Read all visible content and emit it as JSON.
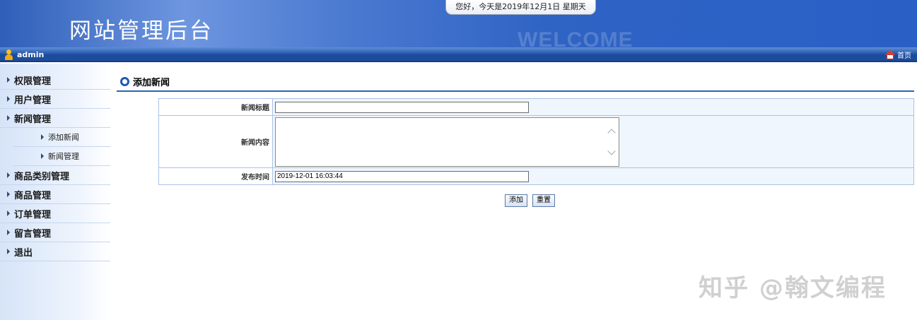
{
  "header": {
    "title": "网站管理后台",
    "welcome_text": "WELCOME",
    "greeting": "您好，今天是2019年12月1日 星期天"
  },
  "topbar": {
    "username": "admin",
    "home_label": "首页"
  },
  "sidebar": {
    "items": [
      {
        "label": "权限管理"
      },
      {
        "label": "用户管理"
      },
      {
        "label": "新闻管理"
      },
      {
        "label": "商品类别管理"
      },
      {
        "label": "商品管理"
      },
      {
        "label": "订单管理"
      },
      {
        "label": "留言管理"
      },
      {
        "label": "退出"
      }
    ],
    "sub_items": [
      {
        "label": "添加新闻"
      },
      {
        "label": "新闻管理"
      }
    ]
  },
  "main": {
    "page_title": "添加新闻",
    "form": {
      "title_label": "新闻标题",
      "title_value": "",
      "content_label": "新闻内容",
      "content_value": "",
      "time_label": "发布时间",
      "time_value": "2019-12-01 16:03:44"
    },
    "buttons": {
      "add": "添加",
      "reset": "重置"
    }
  },
  "watermark": "知乎 @翰文编程",
  "colors": {
    "header_blue": "#2a60c6",
    "topbar_blue": "#1c4c9a",
    "rule_blue": "#2d64b5"
  }
}
